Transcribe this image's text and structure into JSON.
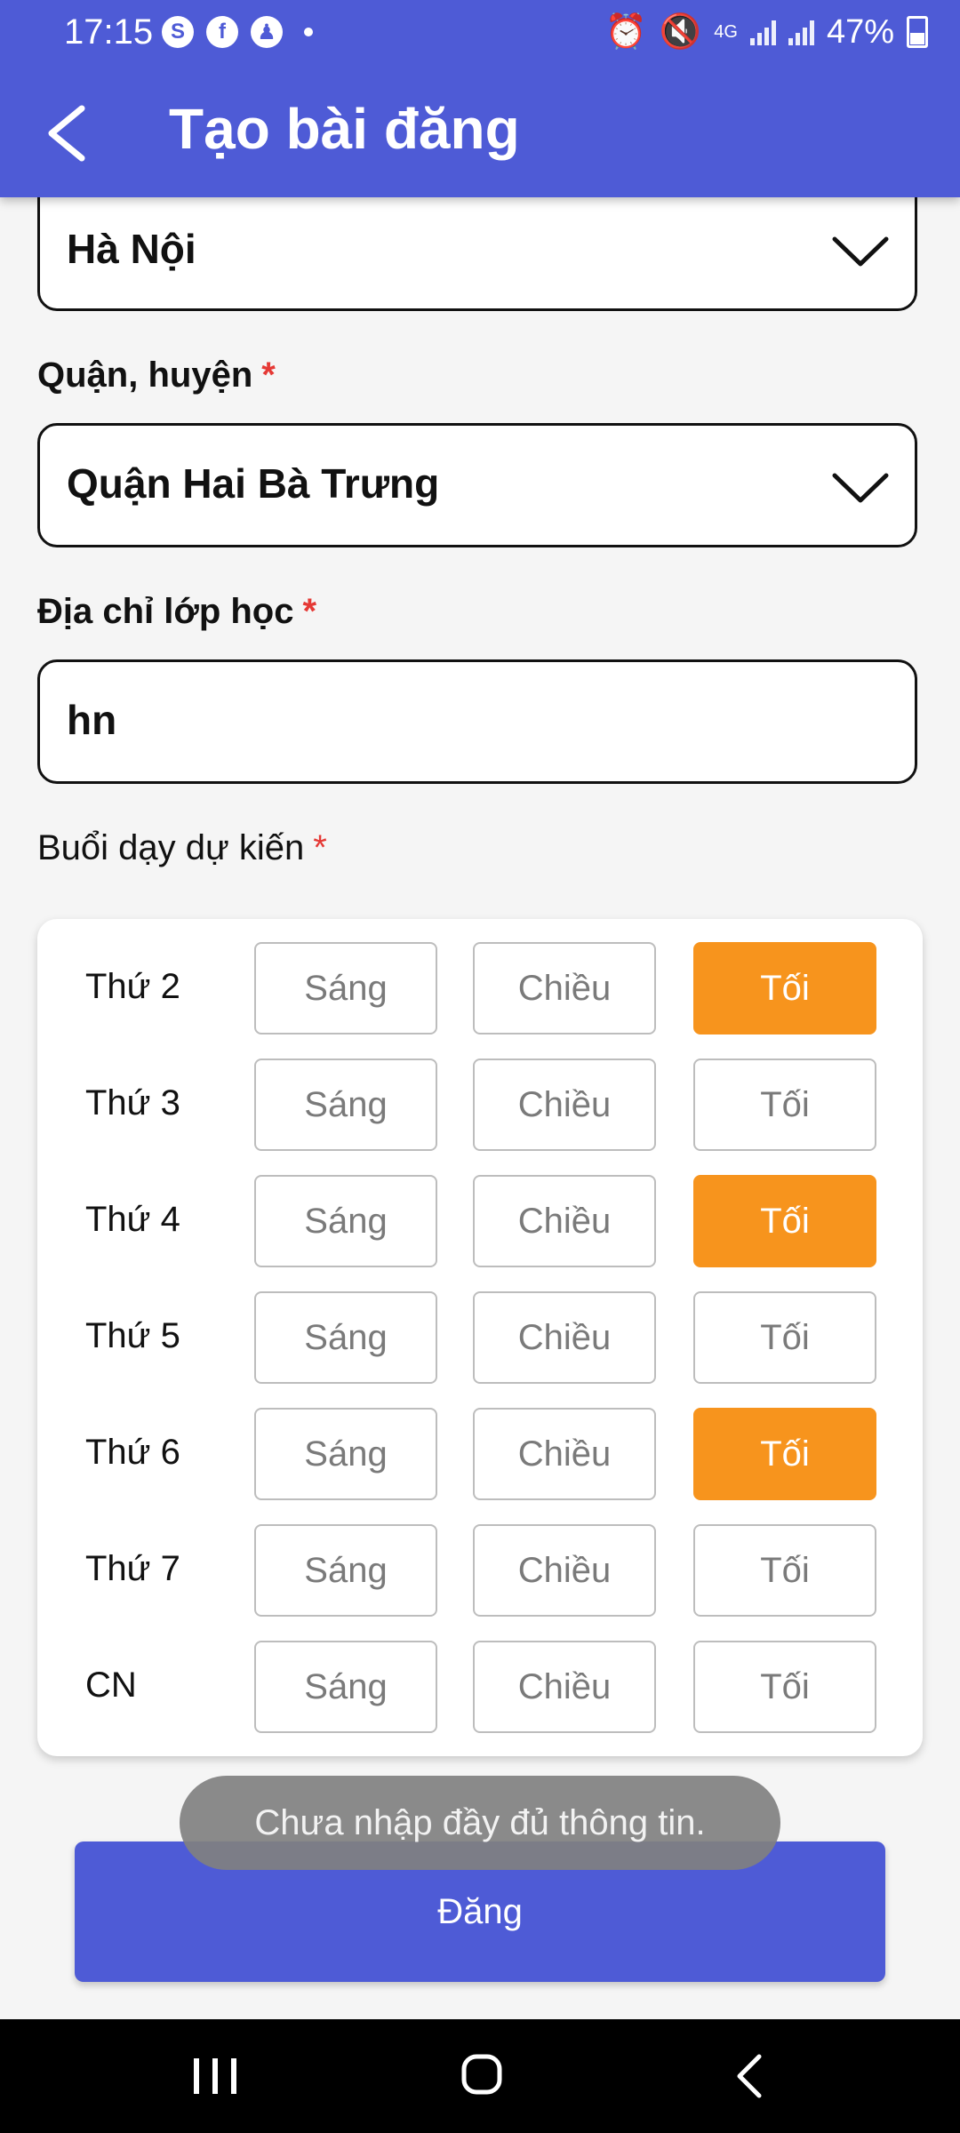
{
  "status_bar": {
    "time": "17:15",
    "left_icons": [
      "skype-icon",
      "facebook-icon",
      "notification-icon"
    ],
    "battery": "47%",
    "network": "4G"
  },
  "header": {
    "title": "Tạo bài đăng",
    "background": "#4e5bd6"
  },
  "form": {
    "city": {
      "value": "Hà Nội"
    },
    "district": {
      "label": "Quận, huyện",
      "required_mark": "*",
      "value": "Quận Hai Bà Trưng"
    },
    "address": {
      "label": "Địa chỉ lớp học",
      "required_mark": "*",
      "value": "hn"
    },
    "schedule": {
      "label": "Buổi dạy dự kiến",
      "required_mark": "*",
      "slot_labels": [
        "Sáng",
        "Chiều",
        "Tối"
      ],
      "selected_color": "#f7941d",
      "days": [
        {
          "name": "Thứ 2",
          "selected": [
            false,
            false,
            true
          ]
        },
        {
          "name": "Thứ 3",
          "selected": [
            false,
            false,
            false
          ]
        },
        {
          "name": "Thứ 4",
          "selected": [
            false,
            false,
            true
          ]
        },
        {
          "name": "Thứ 5",
          "selected": [
            false,
            false,
            false
          ]
        },
        {
          "name": "Thứ 6",
          "selected": [
            false,
            false,
            true
          ]
        },
        {
          "name": "Thứ 7",
          "selected": [
            false,
            false,
            false
          ]
        },
        {
          "name": "CN",
          "selected": [
            false,
            false,
            false
          ]
        }
      ]
    }
  },
  "submit_label": "Đăng",
  "toast": "Chưa nhập đầy đủ thông tin."
}
